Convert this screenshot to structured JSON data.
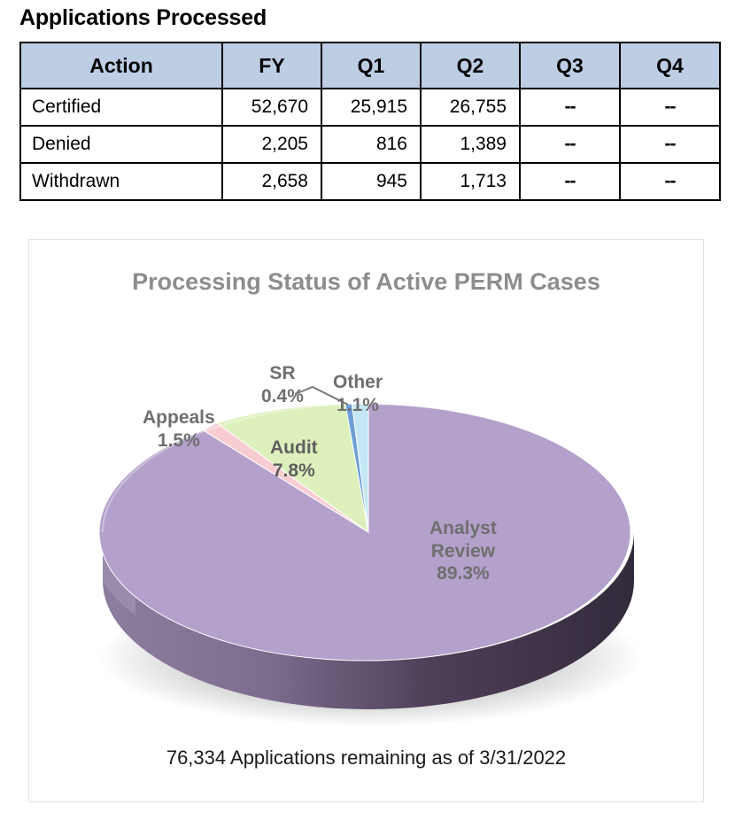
{
  "section": {
    "title": "Applications Processed"
  },
  "table": {
    "columns": [
      "Action",
      "FY",
      "Q1",
      "Q2",
      "Q3",
      "Q4"
    ],
    "rows": [
      {
        "action": "Certified",
        "fy": "52,670",
        "q1": "25,915",
        "q2": "26,755",
        "q3": "--",
        "q4": "--"
      },
      {
        "action": "Denied",
        "fy": "2,205",
        "q1": "816",
        "q2": "1,389",
        "q3": "--",
        "q4": "--"
      },
      {
        "action": "Withdrawn",
        "fy": "2,658",
        "q1": "945",
        "q2": "1,713",
        "q3": "--",
        "q4": "--"
      }
    ],
    "header_fill": "#bdcee4"
  },
  "chart_card": {
    "title": "Processing Status of Active PERM Cases",
    "footnote": "76,334 Applications remaining as of 3/31/2022"
  },
  "chart_data": {
    "type": "pie",
    "title": "Processing Status of Active PERM Cases",
    "subtitle": "",
    "total_label": "76,334 Applications remaining as of 3/31/2022",
    "total": 76334,
    "as_of": "3/31/2022",
    "units": "percent",
    "legend": "none (direct data labels)",
    "three_d": true,
    "start_angle_deg": 0,
    "labels": [
      "Analyst Review",
      "Audit",
      "Appeals",
      "SR",
      "Other"
    ],
    "values": [
      89.3,
      7.8,
      1.5,
      0.4,
      1.1
    ],
    "value_labels": [
      "89.3%",
      "7.8%",
      "1.5%",
      "0.4%",
      "1.1%"
    ],
    "colors": [
      "#b3a0cb",
      "#ddf0bc",
      "#f8cdd2",
      "#6d9ed6",
      "#c4e7f5"
    ],
    "side_colors": [
      "#5c4b66",
      "#9aa88a",
      "#b79499",
      "#4f739c",
      "#8fa9b5"
    ],
    "slices": [
      {
        "name": "Analyst Review",
        "value": 89.3,
        "label": "89.3%",
        "color": "#b3a0cb",
        "label_inside": true
      },
      {
        "name": "Audit",
        "value": 7.8,
        "label": "7.8%",
        "color": "#ddf0bc",
        "label_inside": true
      },
      {
        "name": "Appeals",
        "value": 1.5,
        "label": "1.5%",
        "color": "#f8cdd2",
        "label_inside": false
      },
      {
        "name": "SR",
        "value": 0.4,
        "label": "0.4%",
        "color": "#6d9ed6",
        "label_inside": false,
        "leader_line": true
      },
      {
        "name": "Other",
        "value": 1.1,
        "label": "1.1%",
        "color": "#c4e7f5",
        "label_inside": false
      }
    ]
  },
  "labels": {
    "appeals_name": "Appeals",
    "appeals_value": "1.5%",
    "sr_name": "SR",
    "sr_value": "0.4%",
    "other_name": "Other",
    "other_value": "1.1%",
    "audit_name": "Audit",
    "audit_value": "7.8%",
    "analyst_name_line1": "Analyst",
    "analyst_name_line2": "Review",
    "analyst_value": "89.3%"
  }
}
